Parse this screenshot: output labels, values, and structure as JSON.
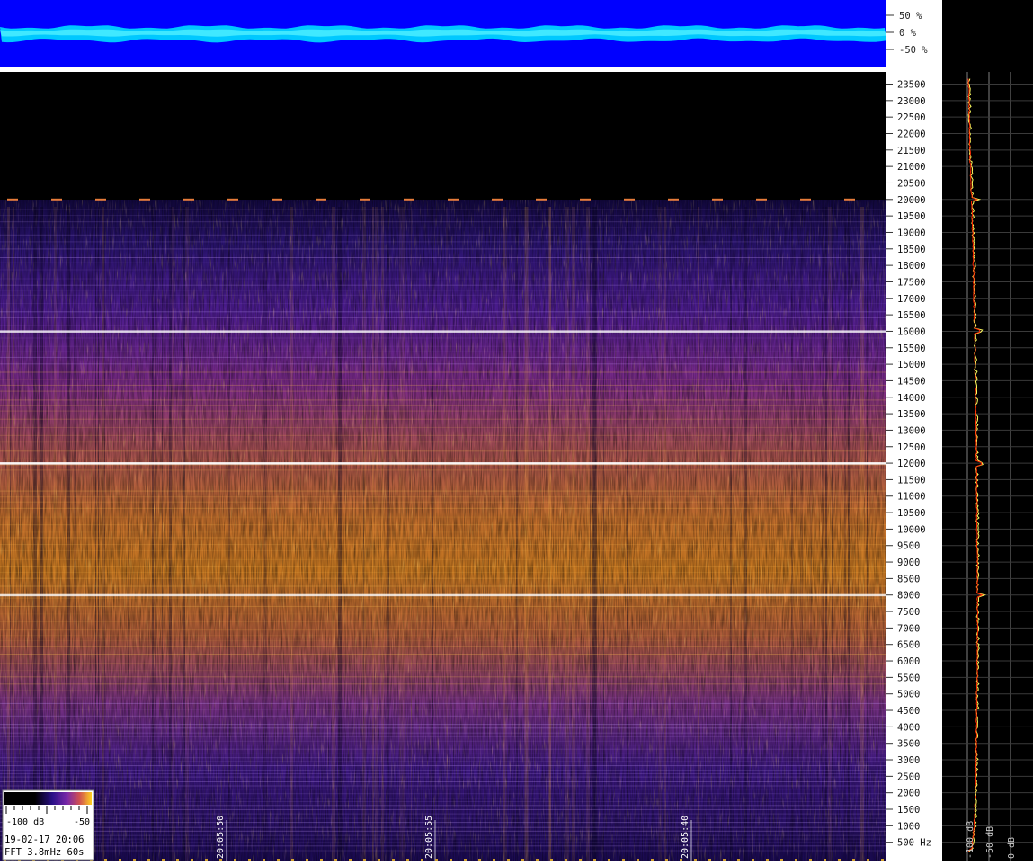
{
  "colors": {
    "waveform_bg": "#0000ff",
    "waveform_band": "#00c8ff",
    "waveform_core": "#40e8ff",
    "spectrogram_top": "#000000",
    "spectrogram_hot": "#ffa010",
    "spectrogram_mid": "#5a1aa0",
    "spectrogram_cold": "#1a0a60",
    "spectrum_line_peak": "#ffff60",
    "spectrum_line_avg": "#ff2a00"
  },
  "waveform_scale": [
    "50 %",
    "0 %",
    "-50 %"
  ],
  "legend": {
    "min_label": "-100 dB",
    "max_label": "-50",
    "timestamp": "19-02-17 20:06",
    "fft_info": "FFT 3.8mHz 60s"
  },
  "chart_data": {
    "type": "heatmap",
    "y_unit": "Hz",
    "ylim": [
      0,
      23800
    ],
    "y_ticks": [
      500,
      1000,
      1500,
      2000,
      2500,
      3000,
      3500,
      4000,
      4500,
      5000,
      5500,
      6000,
      6500,
      7000,
      7500,
      8000,
      8500,
      9000,
      9500,
      10000,
      10500,
      11000,
      11500,
      12000,
      12500,
      13000,
      13500,
      14000,
      14500,
      15000,
      15500,
      16000,
      16500,
      17000,
      17500,
      18000,
      18500,
      19000,
      19500,
      20000,
      20500,
      21000,
      21500,
      22000,
      22500,
      23000,
      23500
    ],
    "y_tick_labels": [
      "500  Hz",
      "1000",
      "1500",
      "2000",
      "2500",
      "3000",
      "3500",
      "4000",
      "4500",
      "5000",
      "5500",
      "6000",
      "6500",
      "7000",
      "7500",
      "8000",
      "8500",
      "9000",
      "9500",
      "10000",
      "10500",
      "11000",
      "11500",
      "12000",
      "12500",
      "13000",
      "13500",
      "14000",
      "14500",
      "15000",
      "15500",
      "16000",
      "16500",
      "17000",
      "17500",
      "18000",
      "18500",
      "19000",
      "19500",
      "20000",
      "20500",
      "21000",
      "21500",
      "22000",
      "22500",
      "23000",
      "23500"
    ],
    "time_labels": [
      "20:05:50",
      "20:05:55",
      "20:05:40"
    ],
    "color_scale_db": [
      -100,
      -50
    ],
    "cutoff_frequency": 20000,
    "tonal_lines": [
      8000,
      12000,
      16000,
      20000
    ],
    "spectrum_axis_labels": [
      "-100 dB",
      "-50 dB",
      "0 dB"
    ],
    "spectrum_profile": {
      "freqs": [
        300,
        1000,
        2000,
        3000,
        4000,
        5000,
        6000,
        7000,
        8000,
        9000,
        10000,
        11000,
        12000,
        13000,
        14000,
        15000,
        16000,
        17000,
        18000,
        19000,
        20000,
        21000,
        22000,
        23000,
        23700
      ],
      "level_db": [
        -90,
        -84,
        -81,
        -80,
        -79,
        -78,
        -77,
        -77,
        -77,
        -77,
        -78,
        -78,
        -79,
        -80,
        -81,
        -82,
        -83,
        -85,
        -86,
        -88,
        -90,
        -93,
        -95,
        -96,
        -97
      ]
    }
  }
}
